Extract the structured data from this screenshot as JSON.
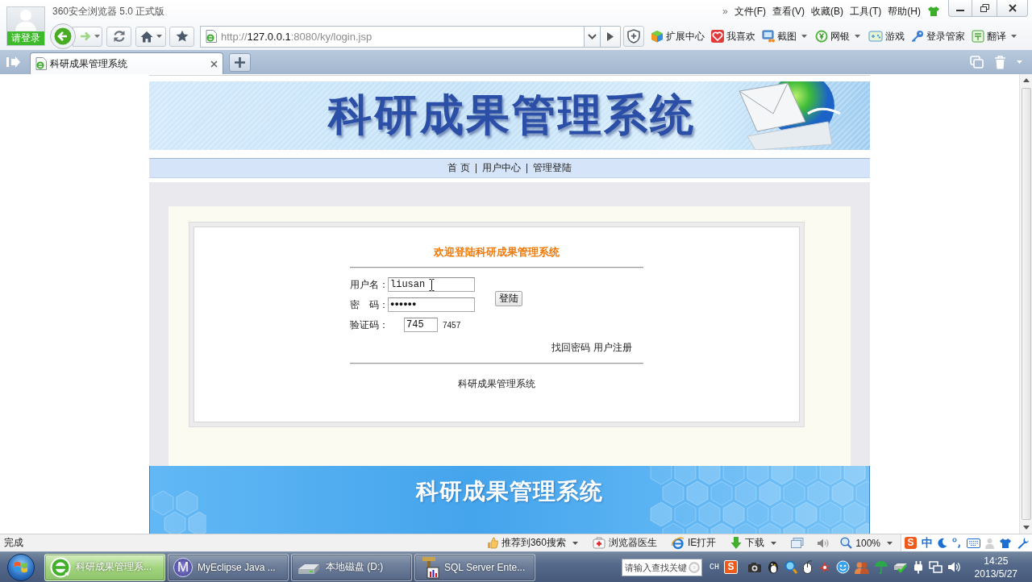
{
  "window": {
    "title": "360安全浏览器 5.0 正式版",
    "login_badge": "请登录",
    "menu_more": "»",
    "menu": [
      "文件(F)",
      "查看(V)",
      "收藏(B)",
      "工具(T)",
      "帮助(H)"
    ]
  },
  "navigation": {
    "url": "http://**127.0.0.1**:8080/ky/login.jsp"
  },
  "toolbar": [
    {
      "label": "扩展中心",
      "dropdown": false
    },
    {
      "label": "我喜欢",
      "dropdown": false
    },
    {
      "label": "截图",
      "dropdown": true
    },
    {
      "label": "网银",
      "dropdown": true
    },
    {
      "label": "游戏",
      "dropdown": false
    },
    {
      "label": "登录管家",
      "dropdown": false
    },
    {
      "label": "翻译",
      "dropdown": true
    }
  ],
  "tabs": [
    {
      "label": "科研成果管理系统",
      "selected": true
    }
  ],
  "page": {
    "banner": {
      "title": "科研成果管理系统"
    },
    "nav_links": [
      "首 页",
      "用户中心",
      "管理登陆"
    ],
    "login": {
      "heading": "欢迎登陆科研成果管理系统",
      "fields": [
        {
          "kind": "text",
          "label": "用户名：",
          "value": "liusan"
        },
        {
          "kind": "password",
          "label": "密　码：",
          "value": "●●●●●●"
        },
        {
          "kind": "captcha",
          "label": "验证码：",
          "value": "745",
          "code": "7457"
        }
      ],
      "submit": "登陆",
      "links": [
        "找回密码",
        "用户注册"
      ],
      "footer": "科研成果管理系统"
    },
    "bottom_banner": {
      "title": "科研成果管理系统"
    }
  },
  "status_bar": {
    "text": "完成",
    "items": [
      {
        "label": "推荐到360搜索",
        "dropdown": true
      },
      {
        "label": "浏览器医生",
        "dropdown": false
      },
      {
        "label": "IE打开",
        "dropdown": false
      },
      {
        "label": "下载",
        "dropdown": true
      }
    ],
    "zoom": "100%",
    "ime": {
      "logo": "S",
      "mode": "中"
    }
  },
  "taskbar": {
    "tasks": [
      {
        "label": "科研成果管理系...",
        "selected": true
      },
      {
        "label": "MyEclipse Java ...",
        "selected": false,
        "icon_text": "M"
      },
      {
        "label": "本地磁盘 (D:)",
        "selected": false
      },
      {
        "label": "SQL Server Ente...",
        "selected": false
      }
    ],
    "search": {
      "placeholder": "请输入查找关键"
    },
    "language": "CH",
    "ime_logo": "S",
    "time": "14:25",
    "date": "2013/5/27"
  }
}
